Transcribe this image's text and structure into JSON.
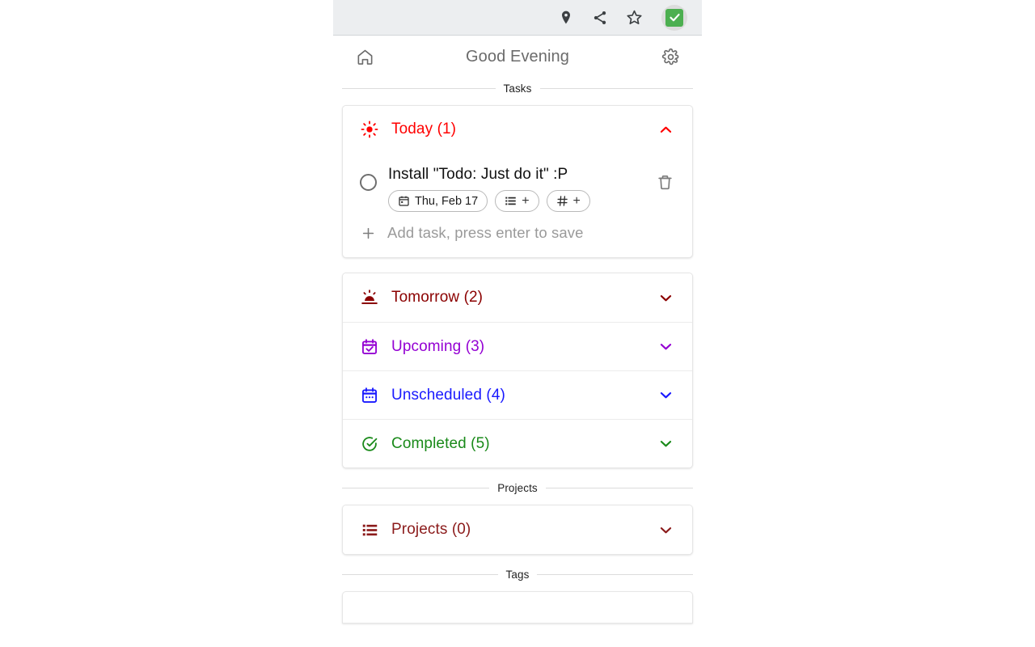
{
  "browser": {
    "icons": [
      {
        "name": "location-pin-icon",
        "label": "Location"
      },
      {
        "name": "share-icon",
        "label": "Share"
      },
      {
        "name": "bookmark-star-icon",
        "label": "Bookmark"
      }
    ],
    "extension": {
      "name": "todo-extension-icon",
      "label": "Todo: Just do it",
      "color": "#4caf50"
    }
  },
  "app": {
    "header": {
      "home_label": "Home",
      "greeting": "Good Evening",
      "settings_label": "Settings"
    },
    "dividers": {
      "tasks": "Tasks",
      "projects": "Projects",
      "tags": "Tags"
    },
    "today": {
      "label": "Today (1)",
      "count": 1,
      "color": "#ff0000",
      "expanded": true,
      "icon": "sun-icon",
      "chevron": "chevron-up-icon"
    },
    "task": {
      "title": "Install \"Todo: Just do it\" :P",
      "completed": false,
      "date_chip": "Thu, Feb 17",
      "project_chip": "+",
      "tag_chip": "+",
      "delete_label": "Delete"
    },
    "add_task": {
      "placeholder": "Add task, press enter to save",
      "plus": "+"
    },
    "sections": [
      {
        "label": "Tomorrow (2)",
        "count": 2,
        "color": "#8b0000",
        "icon": "sunrise-icon",
        "chevron": "chevron-down-icon"
      },
      {
        "label": "Upcoming (3)",
        "count": 3,
        "color": "#9400d3",
        "icon": "calendar-check-icon",
        "chevron": "chevron-down-icon"
      },
      {
        "label": "Unscheduled (4)",
        "count": 4,
        "color": "#1919ff",
        "icon": "calendar-dots-icon",
        "chevron": "chevron-down-icon"
      },
      {
        "label": "Completed (5)",
        "count": 5,
        "color": "#1a8a1a",
        "icon": "check-circle-icon",
        "chevron": "chevron-down-icon"
      }
    ],
    "projects": {
      "label": "Projects (0)",
      "count": 0,
      "color": "#8b1a1a",
      "icon": "list-icon",
      "chevron": "chevron-down-icon"
    }
  }
}
